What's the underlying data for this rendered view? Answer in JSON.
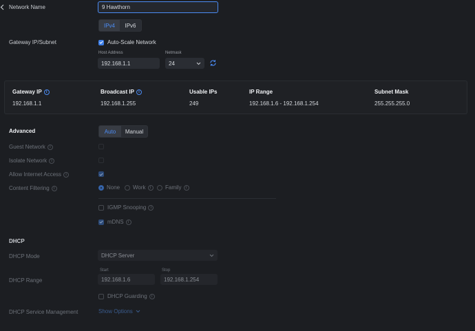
{
  "header": {
    "back_icon": "chevron-left-icon",
    "network_name_label": "Network Name",
    "network_name_value": "9 Hawthorn"
  },
  "ip_version": {
    "options": [
      "IPv4",
      "IPv6"
    ],
    "selected": "IPv4"
  },
  "gateway": {
    "label": "Gateway IP/Subnet",
    "auto_scale_label": "Auto-Scale Network",
    "auto_scale_checked": true,
    "host_address_label": "Host Address",
    "host_address_value": "192.168.1.1",
    "netmask_label": "Netmask",
    "netmask_value": "24",
    "refresh_icon": "refresh-icon"
  },
  "summary": {
    "headers": [
      "Gateway IP",
      "Broadcast IP",
      "Usable IPs",
      "IP Range",
      "Subnet Mask"
    ],
    "values": [
      "192.168.1.1",
      "192.168.1.255",
      "249",
      "192.168.1.6 - 192.168.1.254",
      "255.255.255.0"
    ]
  },
  "advanced": {
    "label": "Advanced",
    "options": [
      "Auto",
      "Manual"
    ],
    "selected": "Auto",
    "guest_network_label": "Guest Network",
    "isolate_network_label": "Isolate Network",
    "allow_internet_label": "Allow Internet Access",
    "content_filtering_label": "Content Filtering",
    "content_filtering_options": [
      "None",
      "Work",
      "Family"
    ],
    "content_filtering_selected": "None",
    "igmp_label": "IGMP Snooping",
    "mdns_label": "mDNS"
  },
  "dhcp": {
    "section_label": "DHCP",
    "mode_label": "DHCP Mode",
    "mode_value": "DHCP Server",
    "range_label": "DHCP Range",
    "start_label": "Start",
    "start_value": "192.168.1.6",
    "stop_label": "Stop",
    "stop_value": "192.168.1.254",
    "guarding_label": "DHCP Guarding",
    "service_mgmt_label": "DHCP Service Management",
    "show_options_label": "Show Options"
  },
  "colors": {
    "accent": "#4c8df6",
    "background": "#1c1e22",
    "checkbox": "#3d7fe8"
  }
}
